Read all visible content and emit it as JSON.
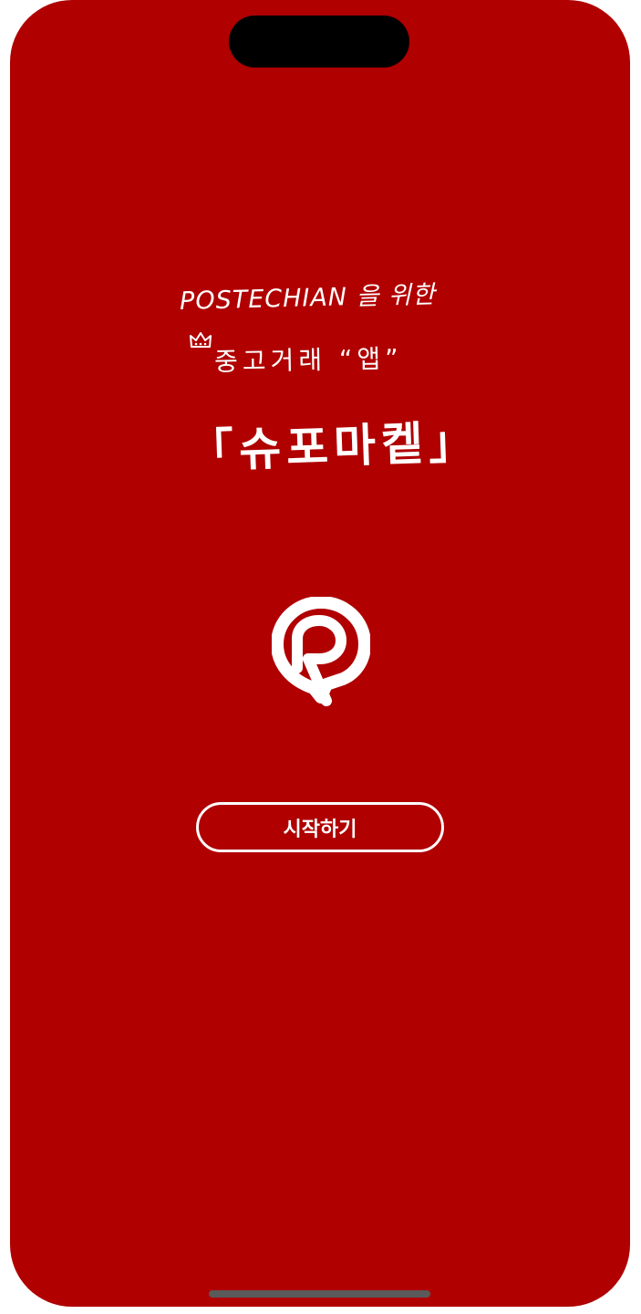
{
  "splash": {
    "tagline_line1": "POSTECHIAN 을 위한",
    "tagline_line2": "중고거래 “앱”",
    "app_name": "「슈포마켙」",
    "start_button_label": "시작하기"
  },
  "colors": {
    "background": "#b00000",
    "foreground": "#ffffff"
  },
  "icons": {
    "crown": "crown-icon",
    "logo": "app-logo-icon"
  }
}
